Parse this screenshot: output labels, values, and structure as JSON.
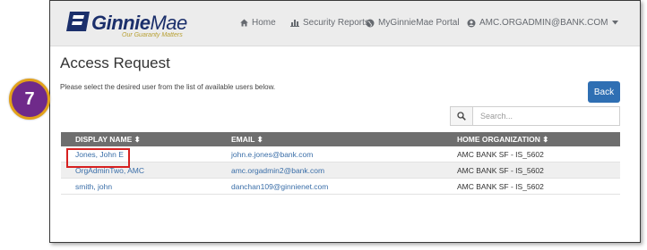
{
  "brand": {
    "name_bold": "Ginnie",
    "name_light": "Mae",
    "tagline": "Our Guaranty Matters",
    "primary_color": "#1b2f6b",
    "accent_color": "#b8a033"
  },
  "nav": {
    "home": {
      "label": "Home",
      "icon": "home-icon"
    },
    "security_reports": {
      "label": "Security Reports",
      "icon": "bar-chart-icon"
    },
    "portal": {
      "label": "MyGinnieMae Portal",
      "icon": "globe-icon"
    },
    "user": {
      "label": "AMC.ORGADMIN@BANK.COM",
      "icon": "user-circle-icon",
      "dropdown_icon": "caret-down-icon"
    }
  },
  "page": {
    "title": "Access Request",
    "instructions": "Please select the desired user from the list of available users below.",
    "back_label": "Back",
    "back_color": "#2f6fb3"
  },
  "search": {
    "placeholder": "Search...",
    "icon": "search-icon"
  },
  "table": {
    "headers": [
      "DISPLAY NAME ⬍",
      "EMAIL ⬍",
      "HOME ORGANIZATION ⬍"
    ],
    "header_bg": "#6e6e6e",
    "rows": [
      {
        "name": "Jones, John E",
        "email": "john.e.jones@bank.com",
        "org": "AMC BANK SF - IS_5602"
      },
      {
        "name": "OrgAdminTwo, AMC",
        "email": "amc.orgadmin2@bank.com",
        "org": "AMC BANK SF - IS_5602"
      },
      {
        "name": "smith, john",
        "email": "danchan109@ginnienet.com",
        "org": "AMC BANK SF - IS_5602"
      }
    ]
  },
  "callout": {
    "step_number": "7",
    "badge_color": "#6f2a8a",
    "badge_border": "#e2a11a",
    "highlight_color": "#d62020"
  }
}
